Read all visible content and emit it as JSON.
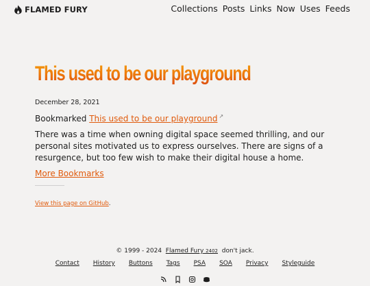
{
  "header": {
    "brand_text": "FLAMED FURY",
    "brand_icon": "flame-icon",
    "nav": [
      {
        "label": "Collections"
      },
      {
        "label": "Posts"
      },
      {
        "label": "Links"
      },
      {
        "label": "Now"
      },
      {
        "label": "Uses"
      },
      {
        "label": "Feeds"
      }
    ]
  },
  "post": {
    "title": "This used to be our playground",
    "date": "December 28, 2021",
    "bookmarked_prefix": "Bookmarked",
    "bookmarked_link": "This used to be our playground",
    "external_icon": "external-link-icon",
    "summary": "There was a time when owning digital space seemed thrilling, and our personal sites motivated us to express ourselves. There are signs of a resurgence, but too few wish to make their digital house a home.",
    "more_link": "More Bookmarks",
    "github_link": "View this page on GitHub",
    "github_suffix": "."
  },
  "footer": {
    "copyright_prefix": "© 1999 - 2024",
    "site_name": "Flamed Fury",
    "version": "2402",
    "tagline": "don't jack.",
    "links": [
      {
        "label": "Contact"
      },
      {
        "label": "History"
      },
      {
        "label": "Buttons"
      },
      {
        "label": "Tags"
      },
      {
        "label": "PSA"
      },
      {
        "label": "SOA"
      },
      {
        "label": "Privacy"
      },
      {
        "label": "Styleguide"
      }
    ],
    "social_icons": [
      "rss-icon",
      "bookmark-icon",
      "instagram-icon",
      "discord-icon"
    ]
  },
  "colors": {
    "accent": "#e05a0c",
    "background": "#f3f2f1",
    "text": "#1d1d1d"
  }
}
